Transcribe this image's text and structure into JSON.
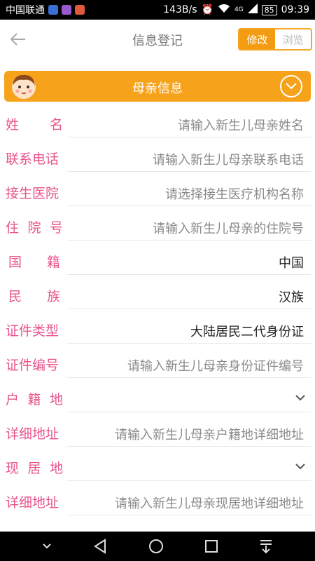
{
  "status_bar": {
    "carrier": "中国联通",
    "speed": "143B/s",
    "network": "4G",
    "battery": "85",
    "time": "09:39"
  },
  "header": {
    "title": "信息登记",
    "modes": [
      "修改",
      "浏览"
    ],
    "active_mode": "修改"
  },
  "section": {
    "title": "母亲信息"
  },
  "fields": [
    {
      "label": "姓名",
      "chars": [
        "姓",
        "名"
      ],
      "value": "请输入新生儿母亲姓名",
      "placeholder": true
    },
    {
      "label": "联系电话",
      "value": "请输入新生儿母亲联系电话",
      "placeholder": true
    },
    {
      "label": "接生医院",
      "value": "请选择接生医疗机构名称",
      "placeholder": true
    },
    {
      "label": "住院号",
      "chars": [
        "住",
        "院",
        "号"
      ],
      "value": "请输入新生儿母亲的住院号",
      "placeholder": true
    },
    {
      "label": "国籍",
      "chars": [
        "国",
        "籍"
      ],
      "value": "中国",
      "placeholder": false
    },
    {
      "label": "民族",
      "chars": [
        "民",
        "族"
      ],
      "value": "汉族",
      "placeholder": false
    },
    {
      "label": "证件类型",
      "value": "大陆居民二代身份证",
      "placeholder": false
    },
    {
      "label": "证件编号",
      "value": "请输入新生儿母亲身份证件编号",
      "placeholder": true
    },
    {
      "label": "户籍地",
      "chars": [
        "户",
        "籍",
        "地"
      ],
      "value": "",
      "dropdown": true
    },
    {
      "label": "详细地址",
      "value": "请输入新生儿母亲户籍地详细地址",
      "placeholder": true
    },
    {
      "label": "现居地",
      "chars": [
        "现",
        "居",
        "地"
      ],
      "value": "",
      "dropdown": true
    },
    {
      "label": "详细地址",
      "value": "请输入新生儿母亲现居地详细地址",
      "placeholder": true
    }
  ],
  "colors": {
    "accent": "#f7a21b",
    "label": "#e8538b",
    "placeholder": "#8a8a8a"
  }
}
